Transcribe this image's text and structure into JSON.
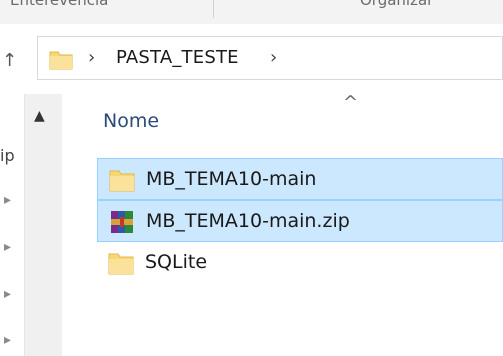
{
  "ribbon": {
    "left_group": "Enterevencia",
    "right_group": "Organizar"
  },
  "address_bar": {
    "folder_icon": "folder-icon",
    "breadcrumb": "PASTA_TESTE",
    "chevron": "›"
  },
  "nav_pane": {
    "fragment_text": "ip",
    "pins": [
      "pin-icon",
      "pin-icon",
      "pin-icon",
      "pin-icon"
    ]
  },
  "column_header": {
    "name": "Nome",
    "sort_indicator": "^"
  },
  "files": [
    {
      "name": "MB_TEMA10-main",
      "icon": "folder-icon",
      "selected": true
    },
    {
      "name": "MB_TEMA10-main.zip",
      "icon": "winrar-archive-icon",
      "selected": true
    },
    {
      "name": "SQLite",
      "icon": "folder-icon",
      "selected": false
    }
  ],
  "colors": {
    "selection_bg": "#cce8ff",
    "selection_border": "#99d1ff",
    "header_text": "#2c4a7a",
    "folder_yellow": "#f8d775"
  }
}
